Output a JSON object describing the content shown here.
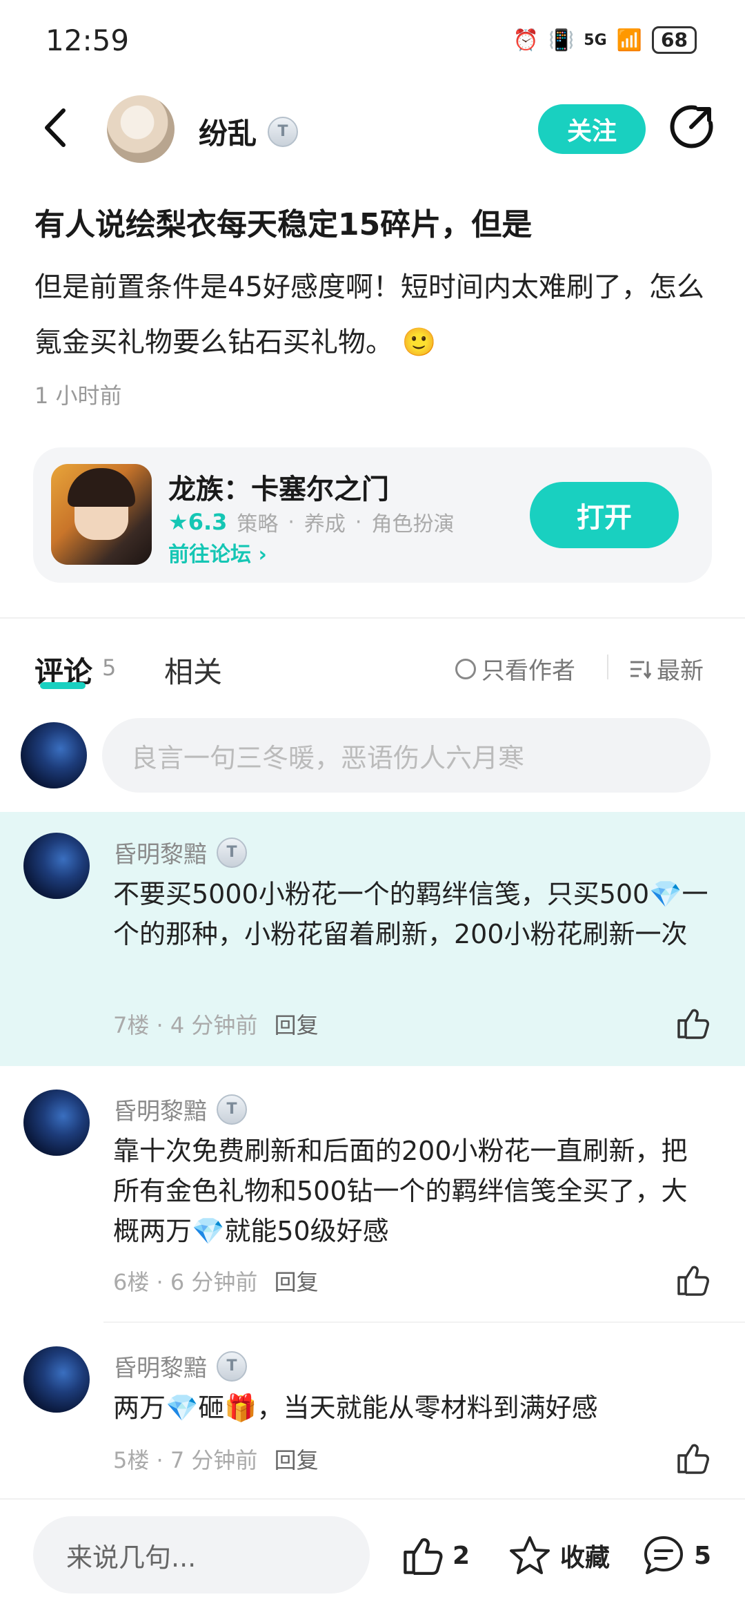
{
  "status": {
    "time": "12:59",
    "network": "5G",
    "battery": "68"
  },
  "header": {
    "author": "纷乱",
    "badge": "T",
    "follow_label": "关注"
  },
  "post": {
    "title": "有人说绘梨衣每天稳定15碎片，但是",
    "body": "但是前置条件是45好感度啊！短时间内太难刷了，怎么氪金买礼物要么钻石买礼物。",
    "emoji": "🙂",
    "time": "1 小时前"
  },
  "game": {
    "name": "龙族：卡塞尔之门",
    "rating": "6.3",
    "tags": [
      "策略",
      "养成",
      "角色扮演"
    ],
    "forum_link": "前往论坛",
    "open_label": "打开"
  },
  "tabs": {
    "comment_label": "评论",
    "comment_count": "5",
    "related_label": "相关",
    "only_author": "只看作者",
    "sort": "最新"
  },
  "comment_input": {
    "placeholder": "良言一句三冬暖，恶语伤人六月寒"
  },
  "comments": [
    {
      "name": "昏明黎黯",
      "badge": "T",
      "text": "不要买5000小粉花一个的羁绊信笺，只买500💎一个的那种，小粉花留着刷新，200小粉花刷新一次",
      "floor": "7楼",
      "time": "4 分钟前",
      "reply": "回复"
    },
    {
      "name": "昏明黎黯",
      "badge": "T",
      "text": "靠十次免费刷新和后面的200小粉花一直刷新，把所有金色礼物和500钻一个的羁绊信笺全买了，大概两万💎就能50级好感",
      "floor": "6楼",
      "time": "6 分钟前",
      "reply": "回复"
    },
    {
      "name": "昏明黎黯",
      "badge": "T",
      "text": "两万💎砸🎁，当天就能从零材料到满好感",
      "floor": "5楼",
      "time": "7 分钟前",
      "reply": "回复"
    }
  ],
  "bottom": {
    "placeholder": "来说几句...",
    "like_count": "2",
    "favorite_label": "收藏",
    "comment_count": "5"
  },
  "colors": {
    "accent": "#19d0c0",
    "highlight_bg": "#e4f7f6"
  }
}
